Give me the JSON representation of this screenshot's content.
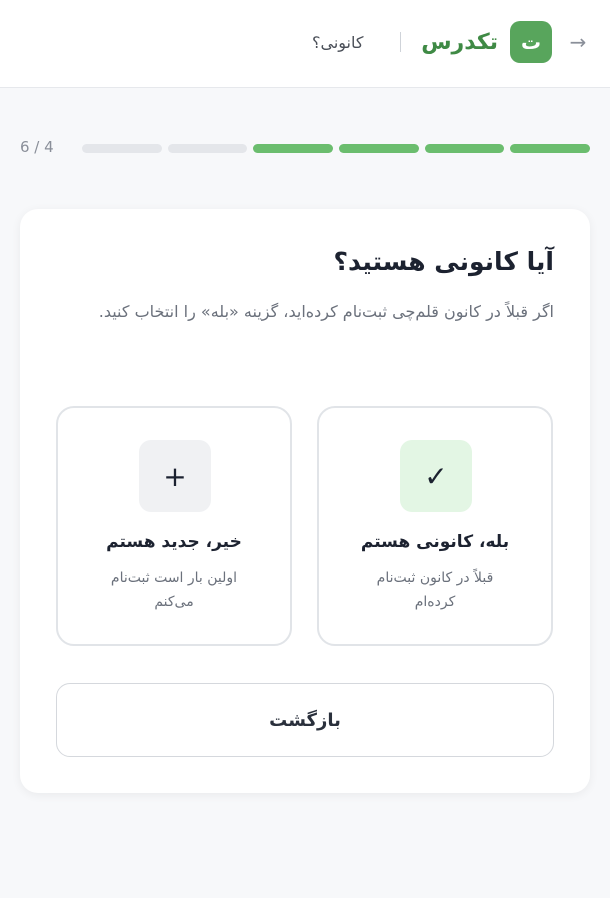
{
  "header": {
    "back_icon": "→",
    "logo_letter": "ت",
    "brand": "تکدرس",
    "page_label": "کانونی؟"
  },
  "progress": {
    "label": "6 / 4",
    "current": 4,
    "total": 6
  },
  "question": {
    "title": "آیا کانونی هستید؟",
    "subtitle": "اگر قبلاً در کانون قلم‌چی ثبت‌نام کرده‌اید، گزینه «بله» را انتخاب کنید."
  },
  "options": [
    {
      "icon": "✓",
      "title": "بله، کانونی هستم",
      "desc": "قبلاً در کانون ثبت‌نام کرده‌ام"
    },
    {
      "icon": "+",
      "title": "خیر، جدید هستم",
      "desc": "اولین بار است ثبت‌نام می‌کنم"
    }
  ],
  "back_button": {
    "label": "بازگشت"
  },
  "colors": {
    "brand": "#58a55c",
    "progress_done": "#6bbd6e",
    "progress_pending": "#e4e6ea"
  }
}
